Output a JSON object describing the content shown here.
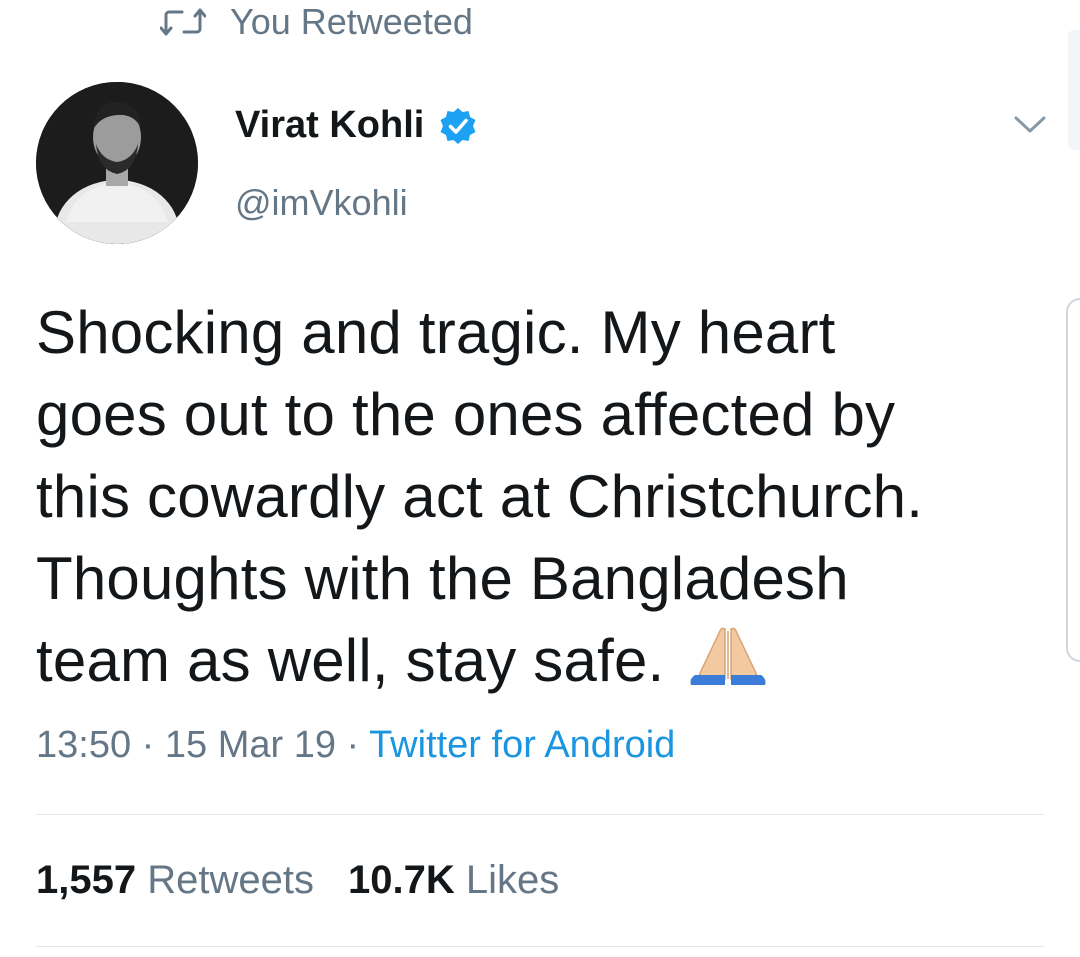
{
  "retweet_banner": {
    "icon": "retweet-icon",
    "label": "You Retweeted"
  },
  "author": {
    "display_name": "Virat Kohli",
    "handle": "@imVkohli",
    "verified": true,
    "verified_icon": "verified-badge-icon",
    "verified_color": "#1da1f2"
  },
  "tweet": {
    "lines": [
      "Shocking and tragic. My heart",
      "goes out to the ones affected by",
      "this cowardly act at Christchurch.",
      "Thoughts with the Bangladesh",
      "team as well, stay safe."
    ],
    "emoji": "folded-hands-icon"
  },
  "meta": {
    "time": "13:50",
    "separator_1": " · ",
    "date": "15 Mar 19",
    "separator_2": " · ",
    "source": "Twitter for Android"
  },
  "stats": {
    "retweets_count": "1,557",
    "retweets_label": "Retweets",
    "likes_count": "10.7K",
    "likes_label": "Likes"
  },
  "colors": {
    "text_primary": "#14171a",
    "text_secondary": "#657786",
    "link": "#1b95e0",
    "divider": "#e1e8ed"
  }
}
